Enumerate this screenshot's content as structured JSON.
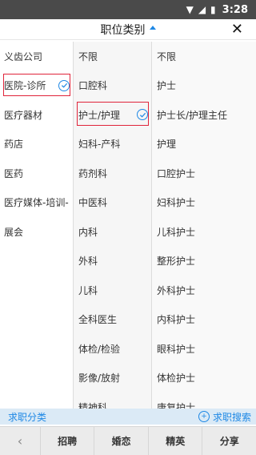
{
  "statusbar": {
    "time": "3:28"
  },
  "header": {
    "title": "职位类别",
    "close": "✕"
  },
  "col1": [
    "义齿公司",
    "医院-诊所",
    "医疗器材",
    "药店",
    "医药",
    "医疗媒体-培训-",
    "展会"
  ],
  "col2": [
    "不限",
    "口腔科",
    "护士/护理",
    "妇科-产科",
    "药剂科",
    "中医科",
    "内科",
    "外科",
    "儿科",
    "全科医生",
    "体检/检验",
    "影像/放射",
    "精神科"
  ],
  "col3": [
    "不限",
    "护士",
    "护士长/护理主任",
    "护理",
    "口腔护士",
    "妇科护士",
    "儿科护士",
    "整形护士",
    "外科护士",
    "内科护士",
    "眼科护士",
    "体检护士",
    "康复护士"
  ],
  "request": {
    "label": "求职分类",
    "search": "求职搜索"
  },
  "nav": {
    "back": "‹",
    "recruit": "招聘",
    "marriage": "婚恋",
    "elite": "精英",
    "share": "分享"
  },
  "colors": {
    "accent": "#1e88e5",
    "highlight": "#e0243a"
  }
}
